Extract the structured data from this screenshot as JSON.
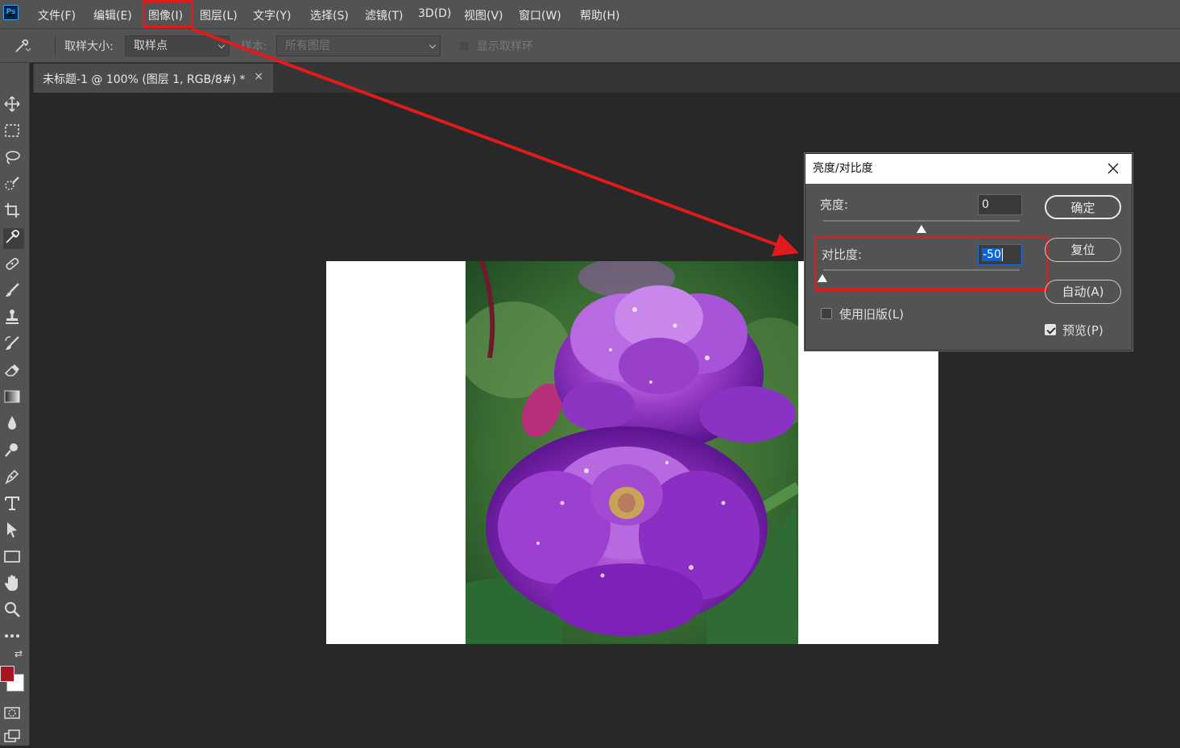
{
  "app": {
    "logo": "Ps"
  },
  "menu": [
    "文件(F)",
    "编辑(E)",
    "图像(I)",
    "图层(L)",
    "文字(Y)",
    "选择(S)",
    "滤镜(T)",
    "3D(D)",
    "视图(V)",
    "窗口(W)",
    "帮助(H)"
  ],
  "options": {
    "sample_size_label": "取样大小:",
    "sample_size_value": "取样点",
    "sample_label": "样本:",
    "sample_value": "所有图层",
    "show_ring_label": "显示取样环"
  },
  "tab": {
    "title": "未标题-1 @ 100% (图层 1, RGB/8#) *",
    "close": "×"
  },
  "dialog": {
    "title": "亮度/对比度",
    "brightness_label": "亮度:",
    "brightness_value": "0",
    "contrast_label": "对比度:",
    "contrast_value": "-50",
    "brightness_slider_level": 0.0,
    "contrast_slider_level": -0.5,
    "legacy_label": "使用旧版(L)",
    "legacy_checked": false,
    "preview_label": "预览(P)",
    "preview_checked": true,
    "ok": "确定",
    "reset": "复位",
    "auto": "自动(A)"
  },
  "colors": {
    "foreground": "#a81420",
    "background": "#ffffff",
    "annotation": "#e11b1b"
  },
  "tools": [
    "move-icon",
    "marquee-icon",
    "lasso-icon",
    "quick-select-icon",
    "crop-icon",
    "eyedropper-icon",
    "healing-icon",
    "brush-icon",
    "stamp-icon",
    "history-brush-icon",
    "eraser-icon",
    "gradient-icon",
    "blur-icon",
    "dodge-icon",
    "pen-icon",
    "type-icon",
    "path-select-icon",
    "rectangle-icon",
    "hand-icon",
    "zoom-icon",
    "more-icon"
  ]
}
